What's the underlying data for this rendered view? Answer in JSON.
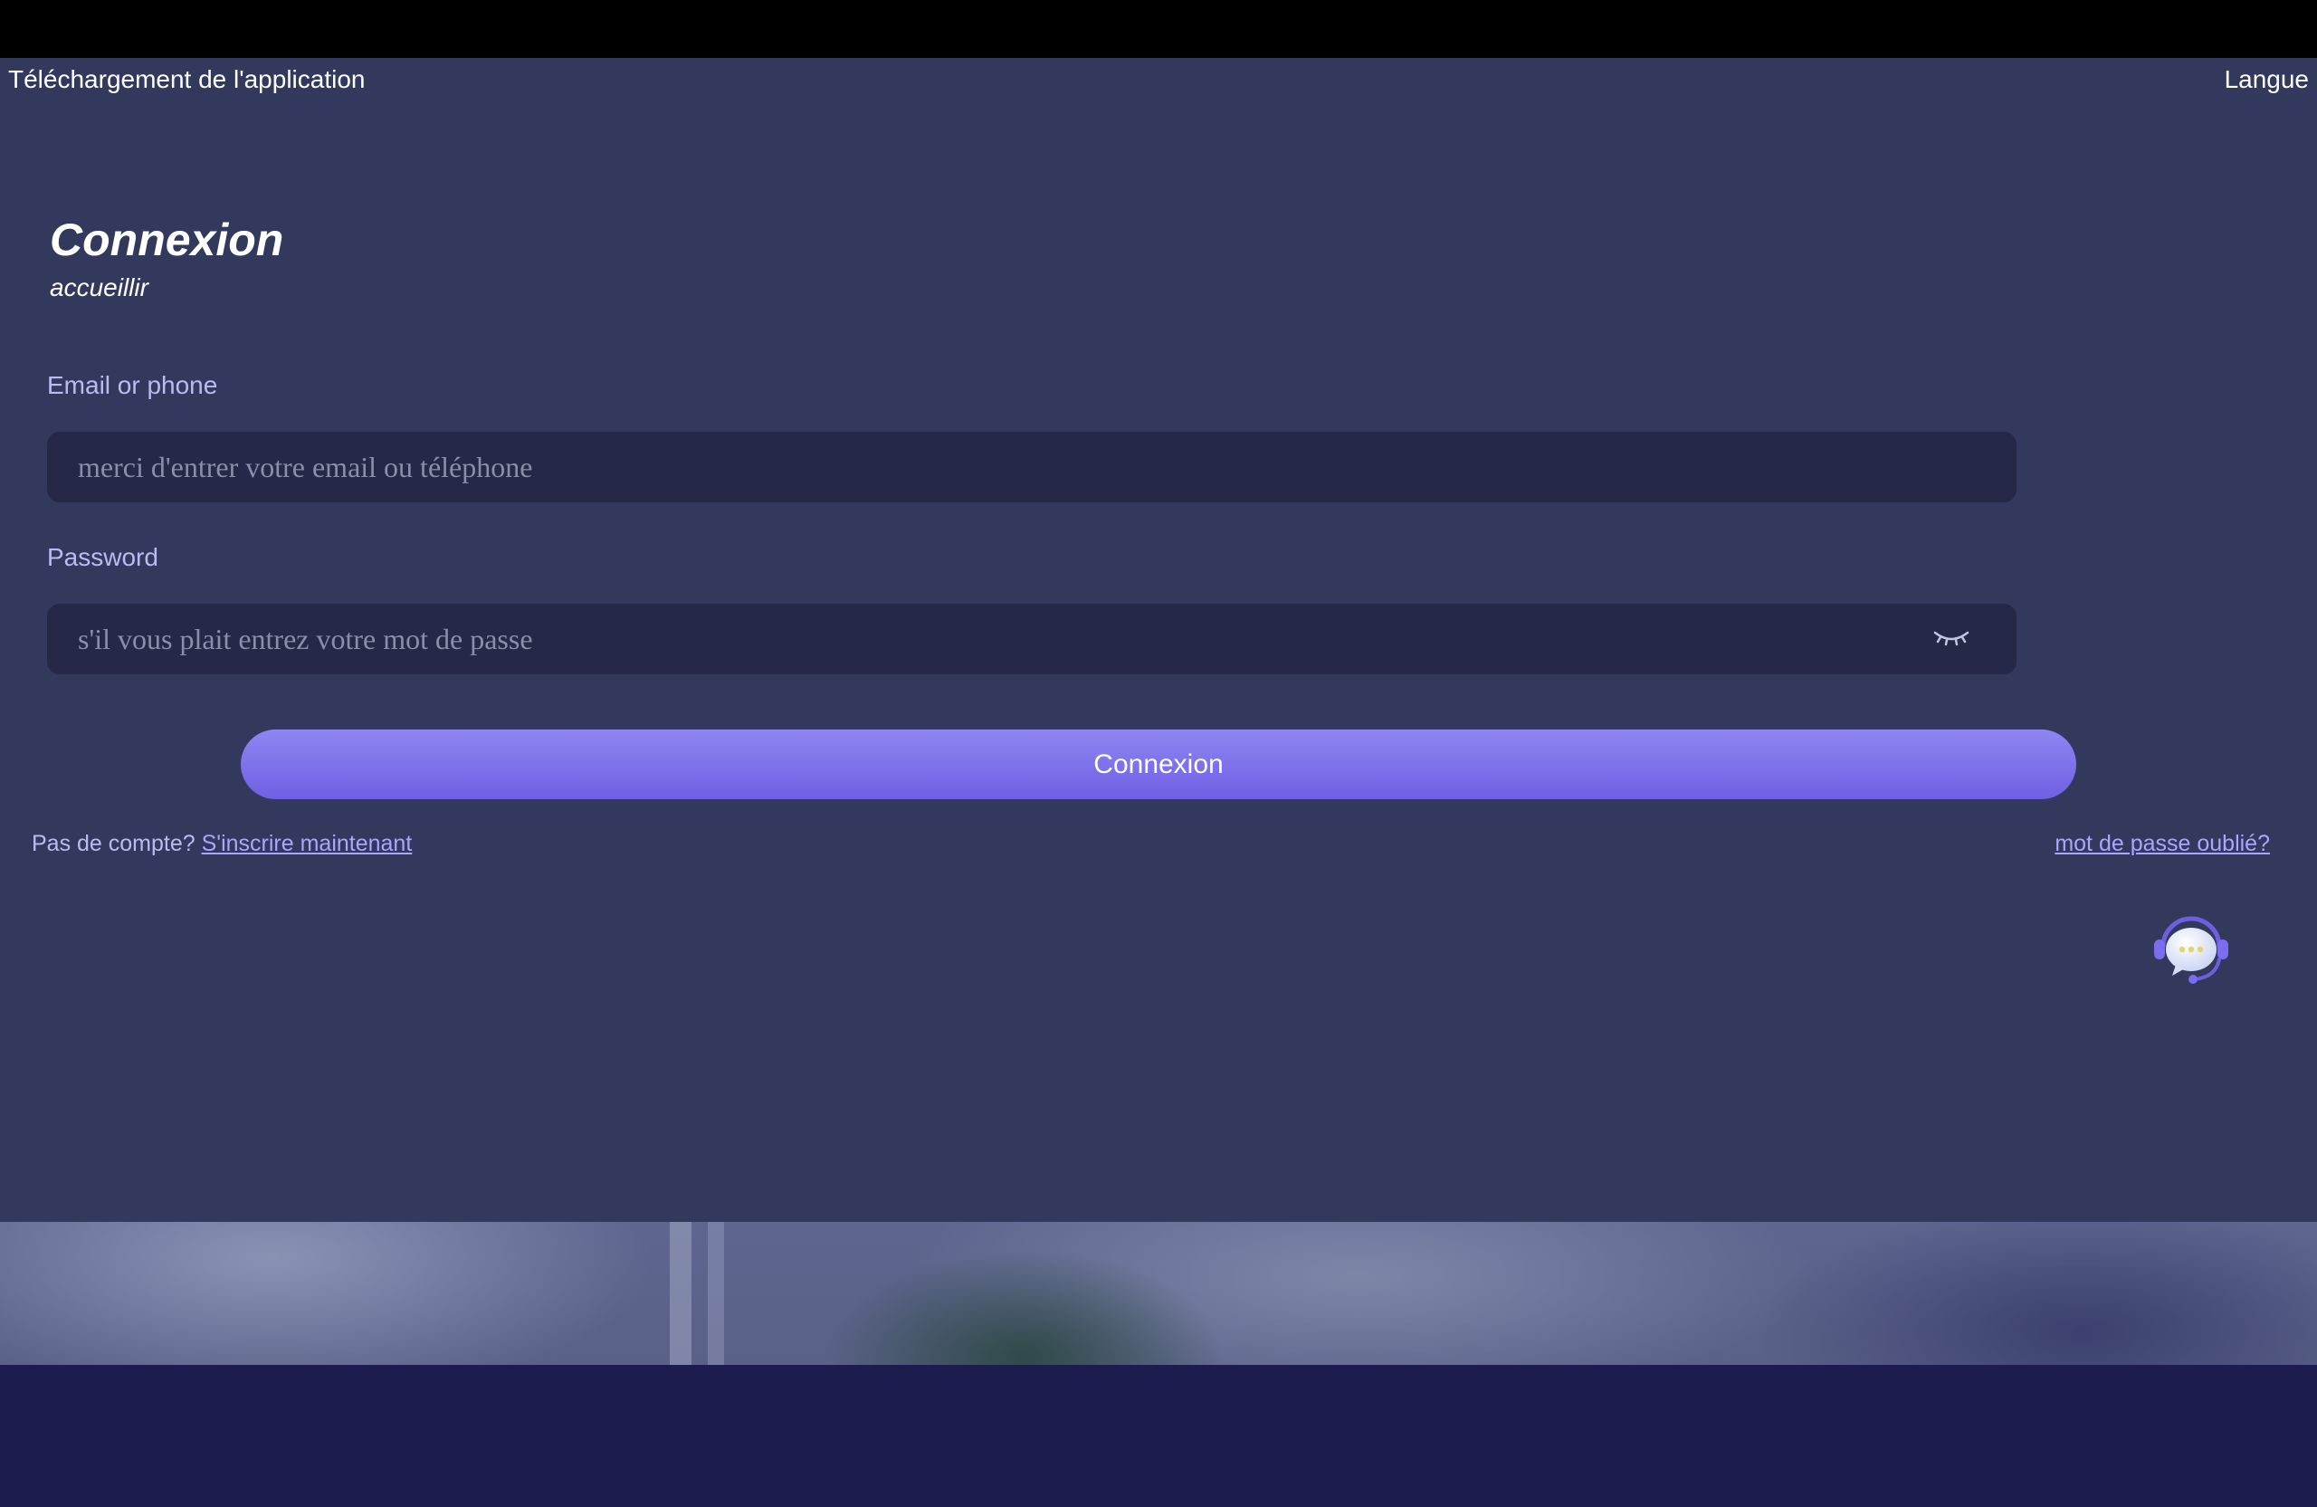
{
  "topbar": {
    "app_download": "Téléchargement de l'application",
    "language": "Langue"
  },
  "login": {
    "title": "Connexion",
    "subtitle": "accueillir",
    "email_label": "Email or phone",
    "email_placeholder": "merci d'entrer votre email ou téléphone",
    "email_value": "",
    "password_label": "Password",
    "password_placeholder": "s'il vous plait entrez votre mot de passe",
    "password_value": "",
    "password_toggle_icon": "eye-closed-icon",
    "submit_label": "Connexion",
    "no_account_text": "Pas de compte?",
    "signup_label": "S'inscrire maintenant",
    "forgot_label": "mot de passe oublié?"
  },
  "support": {
    "icon": "customer-support-chat-icon"
  },
  "colors": {
    "background": "#33395c",
    "input_background": "#252947",
    "label": "#b9bcf2",
    "link": "#a9a6ff",
    "button_gradient_top": "#8f86f2",
    "button_gradient_bottom": "#6f5fe3",
    "footer": "#1c1d4e"
  }
}
